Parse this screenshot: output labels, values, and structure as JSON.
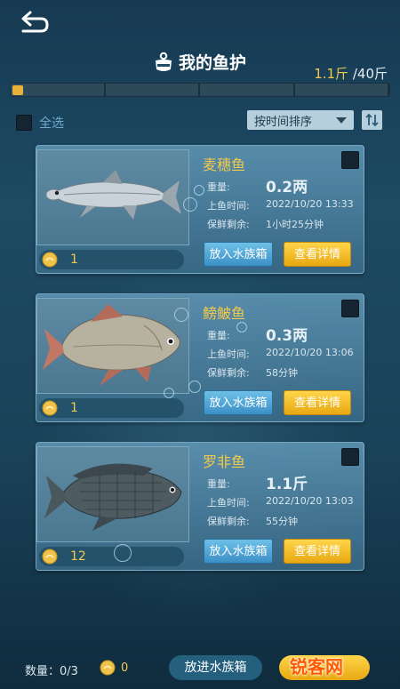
{
  "header": {
    "title": "我的鱼护",
    "capacity_current": "1.1斤",
    "capacity_max": "/40斤",
    "progress_fraction": 0.0275
  },
  "toolbar": {
    "select_all_label": "全选",
    "sort_label": "按时间排序"
  },
  "labels": {
    "weight": "重量:",
    "caught_time": "上鱼时间:",
    "fresh_remaining": "保鲜剩余:",
    "aquarium_button": "放入水族箱",
    "detail_button": "查看详情"
  },
  "fish": [
    {
      "name": "麦穗鱼",
      "weight": "0.2两",
      "time": "2022/10/20  13:33",
      "fresh": "1小时25分钟",
      "count": "1"
    },
    {
      "name": "鳑鲏鱼",
      "weight": "0.3两",
      "time": "2022/10/20  13:06",
      "fresh": "58分钟",
      "count": "1"
    },
    {
      "name": "罗非鱼",
      "weight": "1.1斤",
      "time": "2022/10/20  13:03",
      "fresh": "55分钟",
      "count": "12"
    }
  ],
  "footer": {
    "quantity": "数量：0/3",
    "coin_count": "0",
    "put_aquarium": "放进水族箱"
  },
  "watermark": "锐客网",
  "colors": {
    "accent_gold": "#f2c94c",
    "button_blue": "#3b8fc4",
    "button_gold": "#e8a812"
  },
  "icons": [
    "back-icon",
    "bait-bag-icon",
    "sort-toggle-icon",
    "coin-icon"
  ]
}
